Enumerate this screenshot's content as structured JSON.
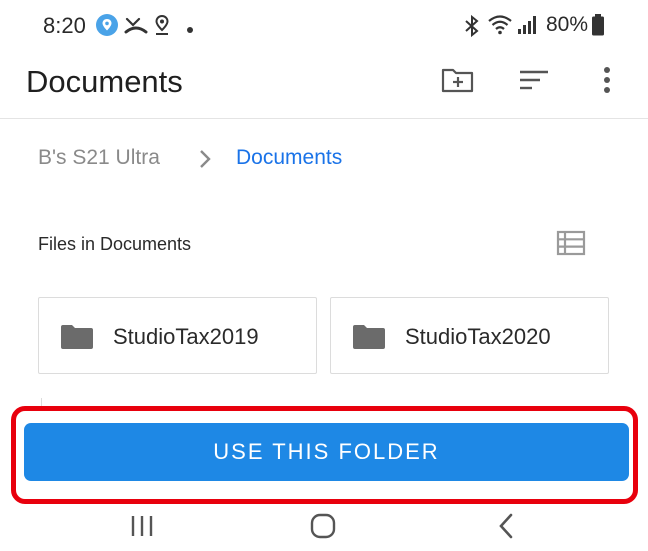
{
  "status_bar": {
    "time": "8:20",
    "battery": "80%",
    "icons": [
      "location-pin-badge-icon",
      "missed-call-icon",
      "location-icon",
      "dot-icon",
      "bluetooth-icon",
      "wifi-icon",
      "signal-icon",
      "battery-icon"
    ]
  },
  "app_bar": {
    "title": "Documents",
    "actions": [
      "new-folder-icon",
      "sort-icon",
      "more-options-icon"
    ]
  },
  "breadcrumb": {
    "root": "B's S21 Ultra",
    "current": "Documents"
  },
  "files_section": {
    "label": "Files in Documents"
  },
  "folders": [
    {
      "name": "StudioTax2019"
    },
    {
      "name": "StudioTax2020"
    }
  ],
  "primary_action": {
    "label": "USE THIS FOLDER"
  },
  "colors": {
    "accent": "#1e88e5",
    "breadcrumb_active": "#1a73e8",
    "highlight": "#e8000d"
  },
  "nav_bar": {
    "buttons": [
      "recents-icon",
      "home-icon",
      "back-icon"
    ]
  }
}
